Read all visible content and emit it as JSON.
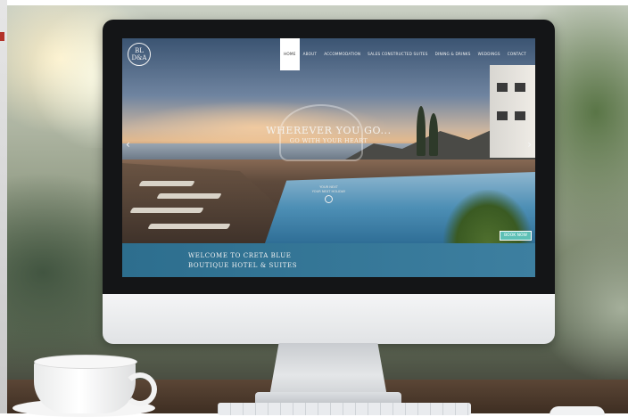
{
  "site": {
    "logo_line1": "BL",
    "logo_line2": "D&A",
    "nav": [
      "HOME",
      "ABOUT",
      "ACCOMMODATION",
      "SALES CONSTRUCTED SUITES",
      "DINING & DRINKS",
      "WEDDINGS",
      "CONTACT"
    ],
    "nav_active": "HOME",
    "hero_headline": "WHEREVER YOU GO...",
    "hero_subline": "GO WITH YOUR HEART",
    "hero_caption_line1": "YOUR NEXT",
    "hero_caption_line2": "YOUR NEXT HOLIDAY",
    "prev_arrow": "‹",
    "next_arrow": "›",
    "book_button": "BOOK NOW",
    "welcome_line1": "WELCOME TO CRETA BLUE",
    "welcome_line2": "BOUTIQUE HOTEL & SUITES"
  },
  "colors": {
    "welcome_bar": "#2d6e8e",
    "book_button": "#5ec0b6",
    "bezel": "#141517"
  }
}
